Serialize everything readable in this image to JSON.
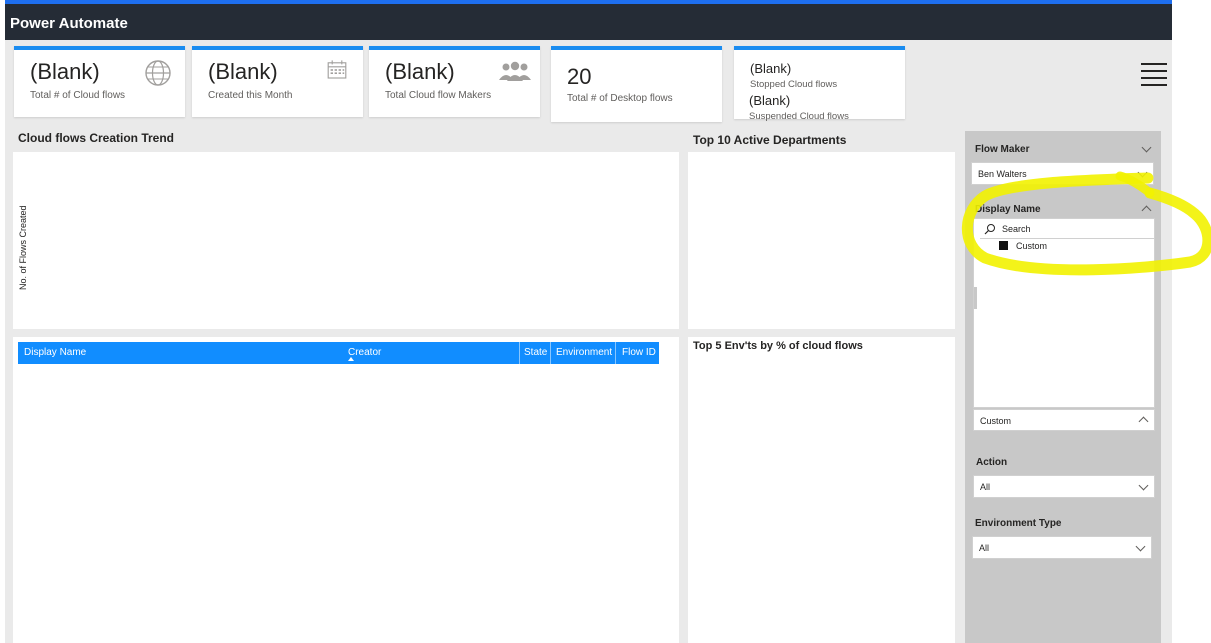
{
  "app": {
    "title": "Power Automate"
  },
  "kpis": [
    {
      "value": "(Blank)",
      "label": "Total # of Cloud flows",
      "icon": "globe-icon"
    },
    {
      "value": "(Blank)",
      "label": "Created this Month",
      "icon": "calendar-icon"
    },
    {
      "value": "(Blank)",
      "label": "Total Cloud flow Makers",
      "icon": "people-icon"
    },
    {
      "value": "20",
      "label": "Total # of Desktop flows"
    },
    {
      "value1": "(Blank)",
      "label1": "Stopped Cloud flows",
      "value2": "(Blank)",
      "label2": "Suspended Cloud flows"
    }
  ],
  "panels": {
    "trend_title": "Cloud flows Creation Trend",
    "trend_ylabel": "No. of Flows Created",
    "top_departments_title": "Top 10 Active Departments",
    "top_envs_title": "Top 5 Env'ts by % of cloud flows"
  },
  "table": {
    "columns": [
      "Display Name",
      "Creator",
      "State",
      "Environment",
      "Flow ID"
    ]
  },
  "filters": {
    "flow_maker": {
      "label": "Flow Maker",
      "value": "Ben Walters"
    },
    "display_name": {
      "label": "Display Name",
      "search_placeholder": "Search",
      "items": [
        "Custom"
      ],
      "selected": "Custom"
    },
    "action": {
      "label": "Action",
      "value": "All"
    },
    "environment_type": {
      "label": "Environment Type",
      "value": "All"
    }
  },
  "colors": {
    "title_bar": "#252c36",
    "accent": "#118dff",
    "highlight": "#f5f500"
  }
}
